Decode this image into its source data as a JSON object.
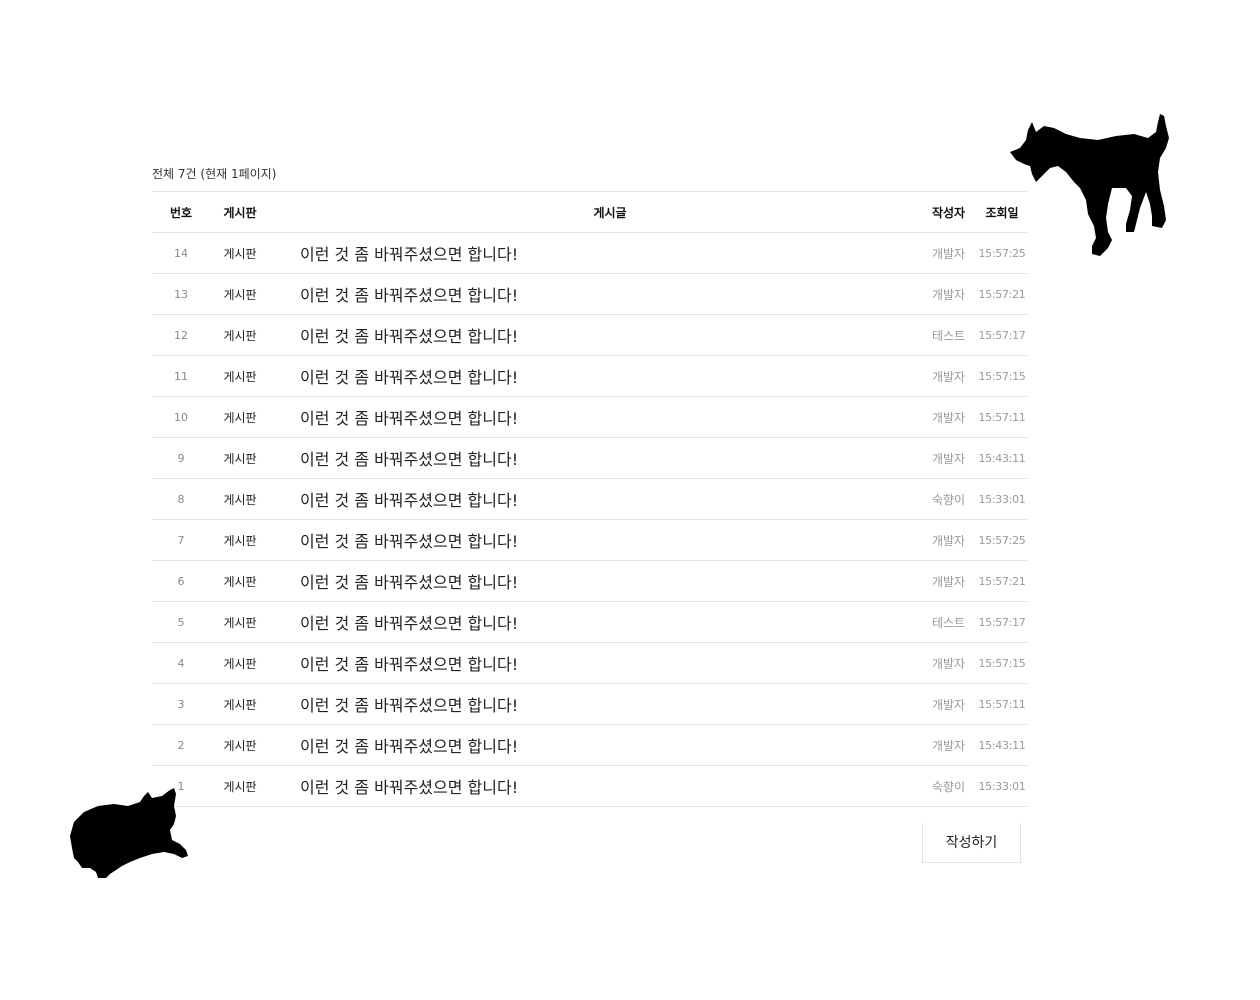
{
  "board": {
    "summary": "전체 7건 (현재 1페이지)",
    "headers": {
      "no": "번호",
      "board": "게시판",
      "title": "게시글",
      "author": "작성자",
      "time": "조회일"
    },
    "rows": [
      {
        "no": "14",
        "board": "게시판",
        "title": "이런 것 좀 바꿔주셨으면 합니다!",
        "author": "개발자",
        "time": "15:57:25"
      },
      {
        "no": "13",
        "board": "게시판",
        "title": "이런 것 좀 바꿔주셨으면 합니다!",
        "author": "개발자",
        "time": "15:57:21"
      },
      {
        "no": "12",
        "board": "게시판",
        "title": "이런 것 좀 바꿔주셨으면 합니다!",
        "author": "테스트",
        "time": "15:57:17"
      },
      {
        "no": "11",
        "board": "게시판",
        "title": "이런 것 좀 바꿔주셨으면 합니다!",
        "author": "개발자",
        "time": "15:57:15"
      },
      {
        "no": "10",
        "board": "게시판",
        "title": "이런 것 좀 바꿔주셨으면 합니다!",
        "author": "개발자",
        "time": "15:57:11"
      },
      {
        "no": "9",
        "board": "게시판",
        "title": "이런 것 좀 바꿔주셨으면 합니다!",
        "author": "개발자",
        "time": "15:43:11"
      },
      {
        "no": "8",
        "board": "게시판",
        "title": "이런 것 좀 바꿔주셨으면 합니다!",
        "author": "숙향이",
        "time": "15:33:01"
      },
      {
        "no": "7",
        "board": "게시판",
        "title": "이런 것 좀 바꿔주셨으면 합니다!",
        "author": "개발자",
        "time": "15:57:25"
      },
      {
        "no": "6",
        "board": "게시판",
        "title": "이런 것 좀 바꿔주셨으면 합니다!",
        "author": "개발자",
        "time": "15:57:21"
      },
      {
        "no": "5",
        "board": "게시판",
        "title": "이런 것 좀 바꿔주셨으면 합니다!",
        "author": "테스트",
        "time": "15:57:17"
      },
      {
        "no": "4",
        "board": "게시판",
        "title": "이런 것 좀 바꿔주셨으면 합니다!",
        "author": "개발자",
        "time": "15:57:15"
      },
      {
        "no": "3",
        "board": "게시판",
        "title": "이런 것 좀 바꿔주셨으면 합니다!",
        "author": "개발자",
        "time": "15:57:11"
      },
      {
        "no": "2",
        "board": "게시판",
        "title": "이런 것 좀 바꿔주셨으면 합니다!",
        "author": "개발자",
        "time": "15:43:11"
      },
      {
        "no": "1",
        "board": "게시판",
        "title": "이런 것 좀 바꿔주셨으면 합니다!",
        "author": "숙향이",
        "time": "15:33:01"
      }
    ]
  },
  "actions": {
    "write_label": "작성하기"
  },
  "decorations": {
    "top_right": "standing-cat-silhouette-icon",
    "bottom_left": "lying-cat-silhouette-icon",
    "color": "#000000"
  }
}
